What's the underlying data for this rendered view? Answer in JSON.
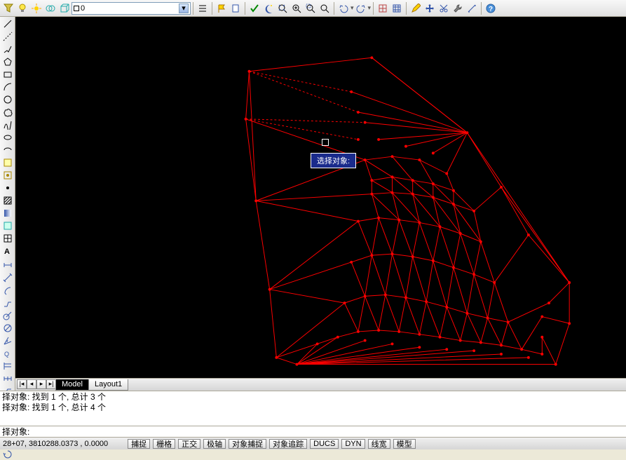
{
  "top_toolbar": {
    "layer_name": "0"
  },
  "tooltip": "选择对象:",
  "tabs": {
    "model": "Model",
    "layout1": "Layout1"
  },
  "command_history": [
    "择对象: 找到 1 个, 总计 3 个",
    "择对象: 找到 1 个, 总计 4 个"
  ],
  "command_prompt": "择对象:",
  "status": {
    "coords": "28+07, 3810288.0373 , 0.0000",
    "buttons": [
      "捕捉",
      "栅格",
      "正交",
      "极轴",
      "对象捕捉",
      "对象追踪",
      "DUCS",
      "DYN",
      "线宽",
      "模型"
    ]
  }
}
